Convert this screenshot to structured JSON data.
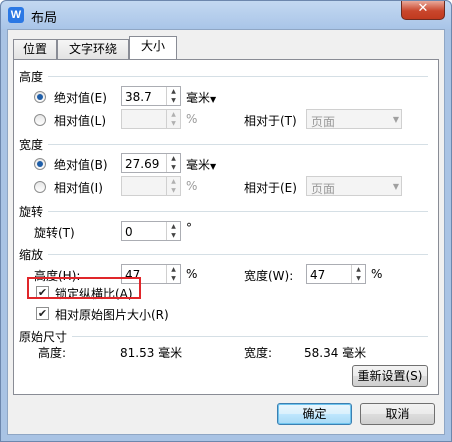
{
  "window": {
    "title": "布局",
    "app_icon": "W",
    "close_label": "✕"
  },
  "tabs": [
    "位置",
    "文字环绕",
    "大小"
  ],
  "height": {
    "section": "高度",
    "absolute_label": "绝对值(E)",
    "absolute_value": "38.7",
    "unit": "毫米",
    "relative_label": "相对值(L)",
    "relative_value": "",
    "percent": "%",
    "relative_to_label": "相对于(T)",
    "relative_to_value": "页面"
  },
  "width": {
    "section": "宽度",
    "absolute_label": "绝对值(B)",
    "absolute_value": "27.69",
    "unit": "毫米",
    "relative_label": "相对值(I)",
    "relative_value": "",
    "percent": "%",
    "relative_to_label": "相对于(E)",
    "relative_to_value": "页面"
  },
  "rotate": {
    "section": "旋转",
    "label": "旋转(T)",
    "value": "0",
    "degree": "°"
  },
  "scale": {
    "section": "缩放",
    "height_label": "高度(H):",
    "height_value": "47",
    "width_label": "宽度(W):",
    "width_value": "47",
    "percent": "%",
    "lock_label": "锁定纵横比(A)",
    "relative_original_label": "相对原始图片大小(R)"
  },
  "original": {
    "section": "原始尺寸",
    "height_label": "高度:",
    "height_value": "81.53 毫米",
    "width_label": "宽度:",
    "width_value": "58.34 毫米",
    "reset_label": "重新设置(S)"
  },
  "buttons": {
    "ok": "确定",
    "cancel": "取消"
  }
}
